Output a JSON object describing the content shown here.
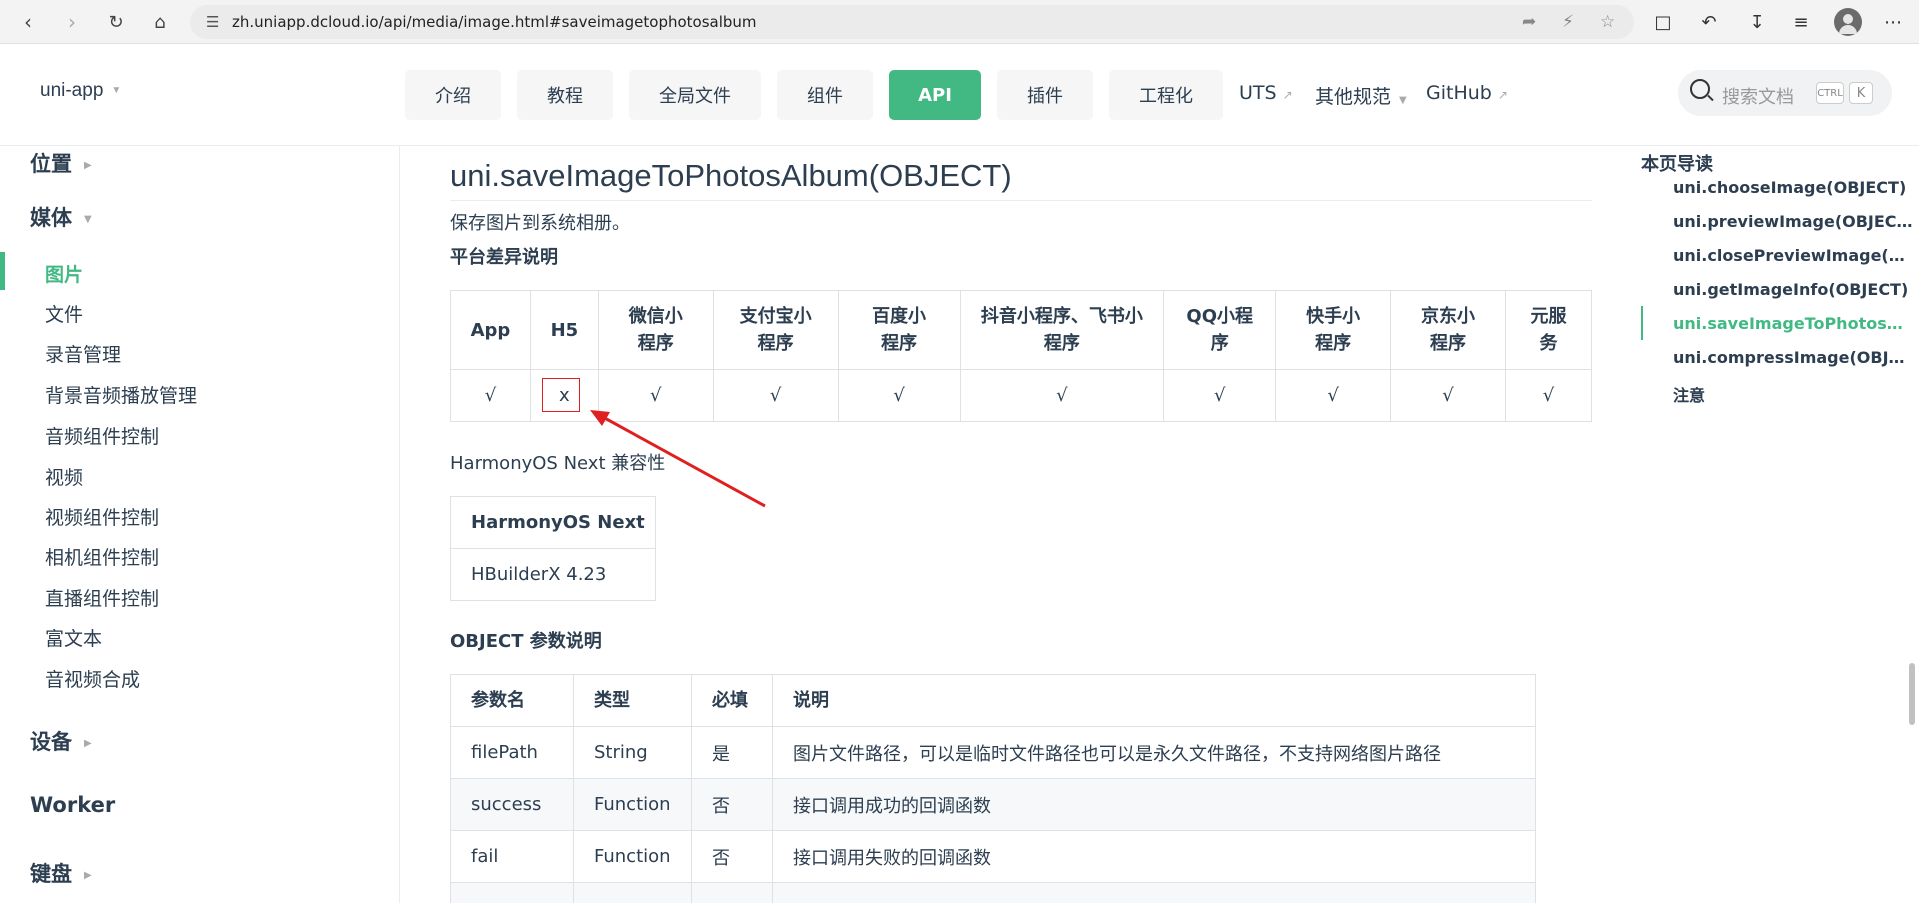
{
  "browser": {
    "url": "zh.uniapp.dcloud.io/api/media/image.html#saveimagetophotosalbum"
  },
  "navbar": {
    "brand": "uni-app",
    "items": [
      {
        "label": "介绍"
      },
      {
        "label": "教程"
      },
      {
        "label": "全局文件"
      },
      {
        "label": "组件"
      },
      {
        "label": "API"
      },
      {
        "label": "插件"
      },
      {
        "label": "工程化"
      }
    ],
    "uts": "UTS",
    "other": "其他规范",
    "github": "GitHub",
    "search_placeholder": "搜索文档",
    "key_ctrl": "CTRL",
    "key_k": "K"
  },
  "sidebar": {
    "heading_location": "位置",
    "heading_media": "媒体",
    "items": [
      {
        "label": "图片"
      },
      {
        "label": "文件"
      },
      {
        "label": "录音管理"
      },
      {
        "label": "背景音频播放管理"
      },
      {
        "label": "音频组件控制"
      },
      {
        "label": "视频"
      },
      {
        "label": "视频组件控制"
      },
      {
        "label": "相机组件控制"
      },
      {
        "label": "直播组件控制"
      },
      {
        "label": "富文本"
      },
      {
        "label": "音视频合成"
      }
    ],
    "heading_device": "设备",
    "heading_worker": "Worker",
    "heading_keyboard": "键盘"
  },
  "main": {
    "title": "uni.saveImageToPhotosAlbum(OBJECT)",
    "desc": "保存图片到系统相册。",
    "platform_heading": "平台差异说明",
    "platform_headers": [
      "App",
      "H5",
      "微信小程序",
      "支付宝小程序",
      "百度小程序",
      "抖音小程序、飞书小程序",
      "QQ小程序",
      "快手小程序",
      "京东小程序",
      "元服务"
    ],
    "platform_values": [
      "√",
      "x",
      "√",
      "√",
      "√",
      "√",
      "√",
      "√",
      "√",
      "√"
    ],
    "harmony_heading": "HarmonyOS Next 兼容性",
    "harmony_header": "HarmonyOS Next",
    "harmony_value": "HBuilderX 4.23",
    "object_heading": "OBJECT 参数说明",
    "object_headers": [
      "参数名",
      "类型",
      "必填",
      "说明"
    ],
    "object_rows": [
      [
        "filePath",
        "String",
        "是",
        "图片文件路径，可以是临时文件路径也可以是永久文件路径，不支持网络图片路径"
      ],
      [
        "success",
        "Function",
        "否",
        "接口调用成功的回调函数"
      ],
      [
        "fail",
        "Function",
        "否",
        "接口调用失败的回调函数"
      ]
    ]
  },
  "toc": {
    "title": "本页导读",
    "items": [
      {
        "label": "uni.chooseImage(OBJECT)"
      },
      {
        "label": "uni.previewImage(OBJECT)"
      },
      {
        "label": "uni.closePreviewImage(OBJECT)"
      },
      {
        "label": "uni.getImageInfo(OBJECT)"
      },
      {
        "label": "uni.saveImageToPhotosAlbum(OBJECT)"
      },
      {
        "label": "uni.compressImage(OBJECT)"
      },
      {
        "label": "注意"
      }
    ]
  },
  "colors": {
    "accent": "#42b983",
    "annotation": "#e02020"
  }
}
